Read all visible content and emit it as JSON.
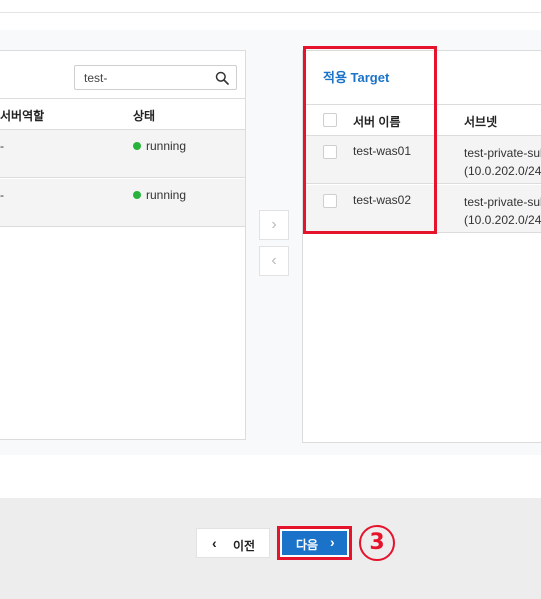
{
  "search": {
    "value": "test-"
  },
  "left_table": {
    "headers": {
      "role": "서버역할",
      "status": "상태"
    },
    "rows": [
      {
        "role": "-",
        "status": "running",
        "status_color": "#28b33c"
      },
      {
        "role": "-",
        "status": "running",
        "status_color": "#28b33c"
      }
    ]
  },
  "move_buttons": {
    "right": "›",
    "left": "‹"
  },
  "right_panel": {
    "title": "적용 Target",
    "headers": {
      "name": "서버 이름",
      "subnet": "서브넷"
    },
    "rows": [
      {
        "name": "test-was01",
        "subnet_line1": "test-private-sul",
        "subnet_line2": "(10.0.202.0/24"
      },
      {
        "name": "test-was02",
        "subnet_line1": "test-private-sul",
        "subnet_line2": "(10.0.202.0/24"
      }
    ]
  },
  "footer": {
    "prev_label": "이전",
    "prev_arrow": "‹",
    "next_label": "다음",
    "next_arrow": "›",
    "step_marker": "③"
  },
  "colors": {
    "accent": "#1a73c8",
    "highlight": "#e5132c",
    "running": "#28b33c"
  },
  "icons": [
    "search-icon",
    "chevron-right-icon",
    "chevron-left-icon"
  ]
}
